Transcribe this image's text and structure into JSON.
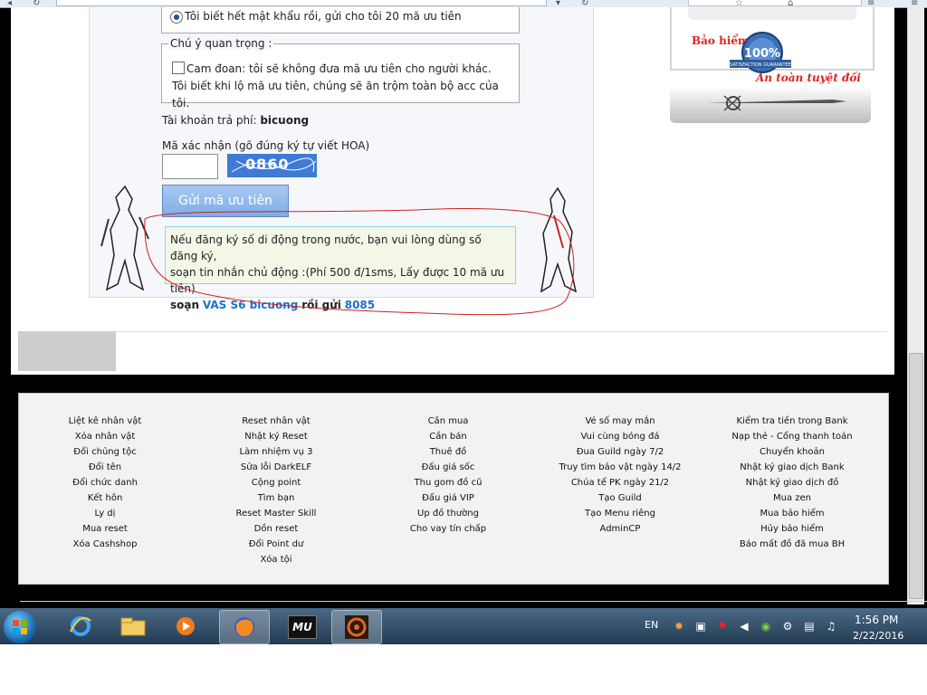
{
  "form": {
    "radio_label": "Tôi biết hết mật khẩu rồi, gửi cho tôi 20 mã ưu tiên",
    "notice_legend": "Chú ý quan trọng :",
    "commit_text": "Cam đoan: tôi sẽ không đưa mã ưu tiên cho người khác. Tôi biết khi lộ mã ưu tiên, chúng sẽ ăn trộm toàn bộ acc của tôi.",
    "account_label": "Tài khoản trả phí:",
    "account_value": "bicuong",
    "captcha_label": "Mã xác nhận (gõ đúng ký tự viết HOA)",
    "captcha_code": "0860",
    "submit_label": "Gửi mã ưu tiên",
    "sms_line1": "Nếu đăng ký số di động trong nước, bạn vui lòng dùng số đăng ký,",
    "sms_line2": "soạn tin nhắn chủ động :(Phí 500 đ/1sms, Lấy được 10 mã ưu tiên)",
    "sms_prefix": "soạn",
    "sms_code": "VAS S6 bicuong",
    "sms_mid": "rồi gửi",
    "sms_number": "8085"
  },
  "banner": {
    "insurance": "Bảo hiểm đồ",
    "safe": "An toàn tuyệt đối",
    "seal_percent": "100%",
    "seal_caption": "SATISFACTION GUARANTEE"
  },
  "footer": {
    "columns": [
      [
        "Liệt kê nhân vật",
        "Xóa nhân vật",
        "Đổi chủng tộc",
        "Đổi tên",
        "Đổi chức danh",
        "Kết hôn",
        "Ly dị",
        "Mua reset",
        "Xóa Cashshop"
      ],
      [
        "Reset nhân vật",
        "Nhật ký Reset",
        "Làm nhiệm vụ 3",
        "Sửa lỗi DarkELF",
        "Cộng point",
        "Tìm bạn",
        "Reset Master Skill",
        "Dồn reset",
        "Đổi Point dư",
        "Xóa tội"
      ],
      [
        "Cần mua",
        "Cần bán",
        "Thuê đồ",
        "Đấu giá sốc",
        "Thu gom đồ cũ",
        "Đấu giá VIP",
        "Up đồ thường",
        "Cho vay tín chấp"
      ],
      [
        "Vé số may mắn",
        "Vui cùng bóng đá",
        "Đua Guild ngày 7/2",
        "Truy tìm bảo vật ngày 14/2",
        "Chúa tể PK ngày 21/2",
        "Tạo Guild",
        "Tạo Menu riêng",
        "AdminCP"
      ],
      [
        "Kiểm tra tiền trong Bank",
        "Nạp thẻ - Cổng thanh toán",
        "Chuyển khoản",
        "Nhật ký giao dịch Bank",
        "Nhật ký giao dịch đồ",
        "Mua zen",
        "Mua bảo hiểm",
        "Hủy bảo hiểm",
        "Báo mất đồ đã mua BH"
      ]
    ]
  },
  "taskbar": {
    "language": "EN",
    "time": "1:56 PM",
    "date": "2/22/2016",
    "apps": [
      "internet-explorer-icon",
      "file-explorer-icon",
      "media-player-icon",
      "firefox-icon",
      "mu-game-icon",
      "game-launcher-icon"
    ],
    "mu_label": "MU"
  }
}
